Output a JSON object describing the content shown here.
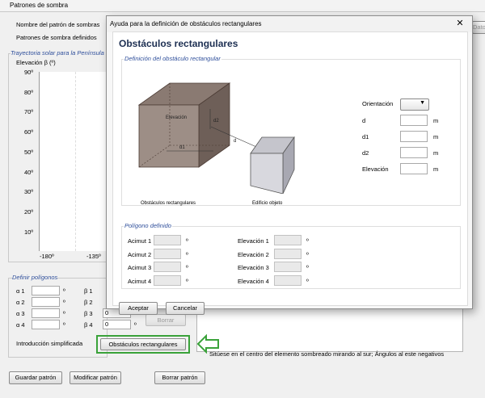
{
  "window": {
    "title": "Patrones de sombra"
  },
  "left_form": {
    "pattern_name_label": "Nombre del patrón de sombras",
    "defined_patterns_label": "Patrones de sombra definidos",
    "side_button_label": "Datos nuevo...",
    "trajectory_title": "Trayectoria solar para la Península Ib",
    "elevation_axis_label": "Elevación β (º)",
    "y_ticks": [
      "90º",
      "80º",
      "70º",
      "60º",
      "50º",
      "40º",
      "30º",
      "20º",
      "10º"
    ],
    "x_ticks": [
      "-180º",
      "-135º"
    ]
  },
  "polygons": {
    "title": "Definir polígonos",
    "alpha_labels": [
      "α 1",
      "α 2",
      "α 3",
      "α 4"
    ],
    "beta_labels": [
      "β 1",
      "β 2",
      "β 3",
      "β 4"
    ],
    "degree": "º",
    "beta3_value": "0",
    "beta4_value": "0",
    "borrar_label": "Borrar"
  },
  "simplified": {
    "label": "Introducción simplificada",
    "button_label": "Obstáculos rectangulares",
    "hint": "Sitúese en el centro del elemento sombreado mirando al sur; Ángulos al este negativos"
  },
  "bottom_buttons": {
    "save": "Guardar patrón",
    "modify": "Modificar patrón",
    "delete": "Borrar patrón"
  },
  "dialog": {
    "title": "Ayuda para la definición de obstáculos rectangulares",
    "close_glyph": "✕",
    "heading": "Obstáculos rectangulares",
    "definition_group": "Definición del obstáculo rectangular",
    "diagram_caption_left": "Obstáculos rectangulares",
    "diagram_caption_right": "Edificio objeto",
    "diagram_labels": {
      "elevation": "Elevación",
      "d1": "d1",
      "d2": "d2",
      "d": "d"
    },
    "orientation_label": "Orientación",
    "fields": [
      {
        "label": "d",
        "unit": "m"
      },
      {
        "label": "d1",
        "unit": "m"
      },
      {
        "label": "d2",
        "unit": "m"
      },
      {
        "label": "Elevación",
        "unit": "m"
      }
    ],
    "polygon_group": "Polígono definido",
    "azimuth_labels": [
      "Acimut 1",
      "Acimut 2",
      "Acimut 3",
      "Acimut 4"
    ],
    "elevation_labels": [
      "Elevación 1",
      "Elevación 2",
      "Elevación 3",
      "Elevación 4"
    ],
    "degree": "º",
    "accept_label": "Aceptar",
    "cancel_label": "Cancelar"
  },
  "colors": {
    "highlight_border": "#3aa23a",
    "group_title": "#2f4f9b",
    "heading": "#1d2f52"
  }
}
